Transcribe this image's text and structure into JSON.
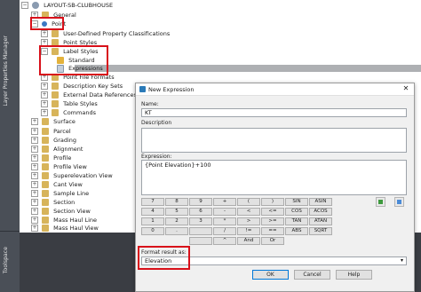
{
  "side_panel": {
    "top_label": "Layer Properties Manager",
    "bottom_label": "Toolspace"
  },
  "tree": {
    "root": "LAYOUT-SB-CLUBHOUSE",
    "items": [
      {
        "label": "General",
        "icon": "folder-icon"
      },
      {
        "label": "Point",
        "icon": "point-icon"
      },
      {
        "label": "User-Defined Property Classifications",
        "icon": "folder-icon"
      },
      {
        "label": "Point Styles",
        "icon": "folder-icon"
      },
      {
        "label": "Label Styles",
        "icon": "folder-icon"
      },
      {
        "label": "Standard",
        "icon": "label-style-icon"
      },
      {
        "label": "Expressions",
        "icon": "expression-icon"
      },
      {
        "label": "Point File Formats",
        "icon": "folder-icon"
      },
      {
        "label": "Description Key Sets",
        "icon": "folder-icon"
      },
      {
        "label": "External Data References",
        "icon": "folder-icon"
      },
      {
        "label": "Table Styles",
        "icon": "folder-icon"
      },
      {
        "label": "Commands",
        "icon": "folder-icon"
      },
      {
        "label": "Surface",
        "icon": "folder-icon"
      },
      {
        "label": "Parcel",
        "icon": "folder-icon"
      },
      {
        "label": "Grading",
        "icon": "folder-icon"
      },
      {
        "label": "Alignment",
        "icon": "folder-icon"
      },
      {
        "label": "Profile",
        "icon": "folder-icon"
      },
      {
        "label": "Profile View",
        "icon": "folder-icon"
      },
      {
        "label": "Superelevation View",
        "icon": "folder-icon"
      },
      {
        "label": "Cant View",
        "icon": "folder-icon"
      },
      {
        "label": "Sample Line",
        "icon": "folder-icon"
      },
      {
        "label": "Section",
        "icon": "folder-icon"
      },
      {
        "label": "Section View",
        "icon": "folder-icon"
      },
      {
        "label": "Mass Haul Line",
        "icon": "folder-icon"
      },
      {
        "label": "Mass Haul View",
        "icon": "folder-icon"
      }
    ]
  },
  "dialog": {
    "title": "New Expression",
    "name_label": "Name:",
    "name_value": "KT",
    "description_label": "Description",
    "description_value": "",
    "expression_label": "Expression:",
    "expression_value": "{Point Elevation}+100",
    "calc_buttons": [
      [
        "7",
        "8",
        "9",
        "+",
        "(",
        ")",
        "SIN",
        "ASIN"
      ],
      [
        "4",
        "5",
        "6",
        "-",
        "<",
        "<=",
        "COS",
        "ACOS"
      ],
      [
        "1",
        "2",
        "3",
        "*",
        ">",
        ">=",
        "TAN",
        "ATAN"
      ],
      [
        "0",
        ".",
        "",
        "/",
        "!=",
        "==",
        "ABS",
        "SQRT"
      ],
      [
        "",
        "",
        "",
        "^",
        "And",
        "Or",
        "",
        ""
      ]
    ],
    "format_label": "Format result as:",
    "format_value": "Elevation",
    "ok_label": "OK",
    "cancel_label": "Cancel",
    "help_label": "Help"
  },
  "colors": {
    "highlight_box": "#d8101a",
    "selection_row": "#aeb0b3",
    "side_panel": "#4a4f57"
  }
}
